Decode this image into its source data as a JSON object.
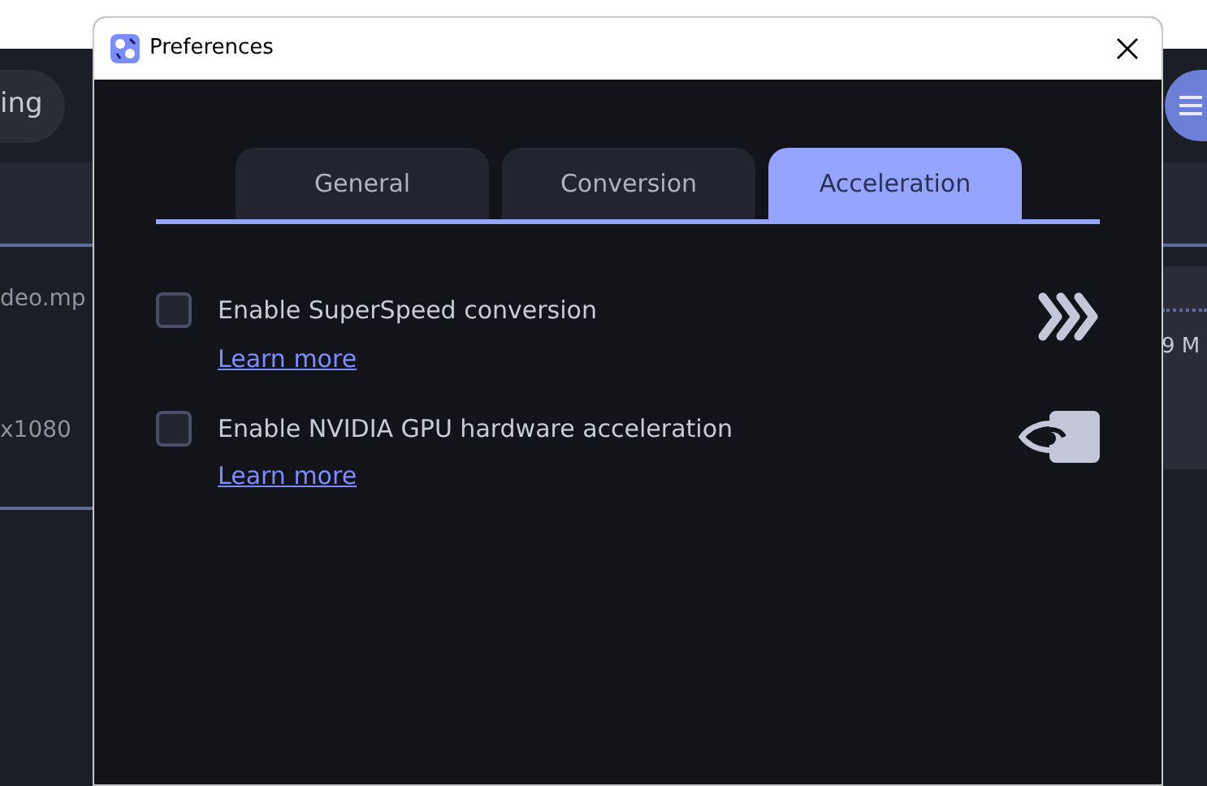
{
  "background_app": {
    "left_button": "ing",
    "left_cells": [
      "deo.mp",
      "x1080"
    ],
    "right_cells": [
      "9 M"
    ]
  },
  "window": {
    "title": "Preferences"
  },
  "tabs": [
    {
      "label": "General",
      "selected": false
    },
    {
      "label": "Conversion",
      "selected": false
    },
    {
      "label": "Acceleration",
      "selected": true
    }
  ],
  "options": [
    {
      "kind": "superspeed",
      "label": "Enable SuperSpeed conversion",
      "checked": false,
      "link": "Learn more"
    },
    {
      "kind": "gpu",
      "label": "Enable NVIDIA GPU hardware acceleration",
      "checked": false,
      "link": "Learn more"
    }
  ]
}
